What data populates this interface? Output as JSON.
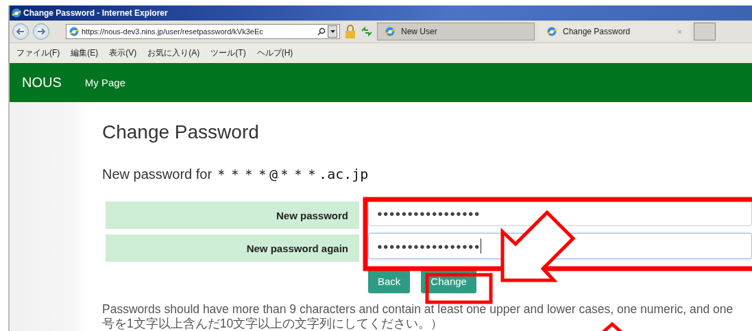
{
  "window": {
    "title": "Change Password - Internet Explorer"
  },
  "address_bar": {
    "url": "https://nous-dev3.nins.jp/user/resetpassword/kVk3eEc"
  },
  "tabs": [
    {
      "label": "New User",
      "selected": false
    },
    {
      "label": "Change Password",
      "selected": true,
      "close": "×"
    }
  ],
  "menu": [
    "ファイル(F)",
    "編集(E)",
    "表示(V)",
    "お気に入り(A)",
    "ツール(T)",
    "ヘルプ(H)"
  ],
  "navbar": {
    "brand": "NOUS",
    "links": [
      "My Page"
    ]
  },
  "page": {
    "heading": "Change Password",
    "subtitle": "New password for",
    "email": "＊＊＊＊@＊＊＊.ac.jp",
    "fields": [
      {
        "label": "New password",
        "value": "●●●●●●●●●●●●●●●●●",
        "focused": false
      },
      {
        "label": "New password again",
        "value": "●●●●●●●●●●●●●●●●●",
        "focused": true
      }
    ],
    "buttons": [
      "Back",
      "Change"
    ],
    "help": [
      "Passwords should have more than 9 characters and contain at least one upper and lower cases, one numeric, and one",
      "号を1文字以上含んだ10文字以上の文字列にしてください。）"
    ]
  }
}
